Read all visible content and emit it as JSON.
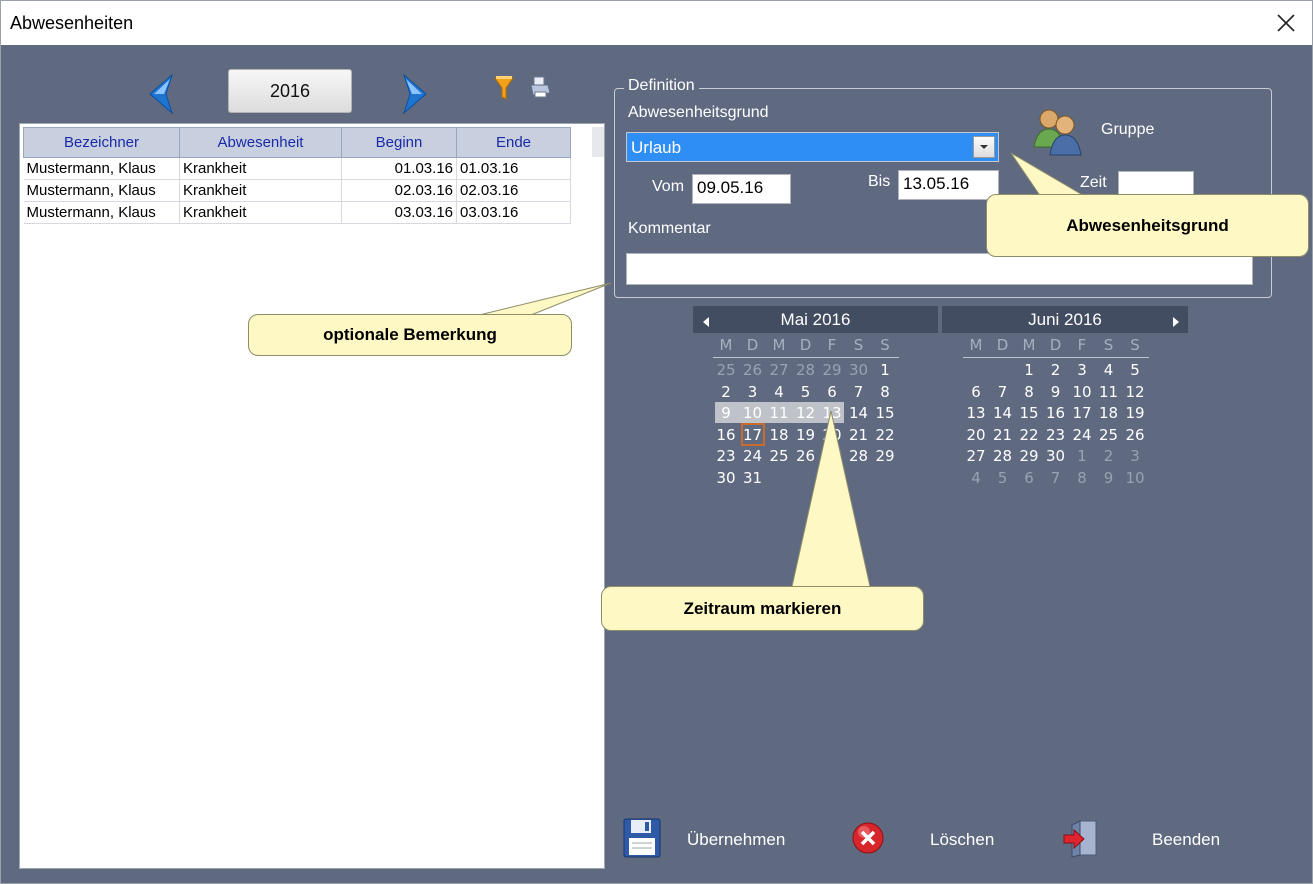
{
  "window": {
    "title": "Abwesenheiten"
  },
  "toolbar": {
    "year": "2016"
  },
  "table": {
    "headers": [
      "Bezeichner",
      "Abwesenheit",
      "Beginn",
      "Ende"
    ],
    "rows": [
      [
        "Mustermann, Klaus",
        "Krankheit",
        "01.03.16",
        "01.03.16"
      ],
      [
        "Mustermann, Klaus",
        "Krankheit",
        "02.03.16",
        "02.03.16"
      ],
      [
        "Mustermann, Klaus",
        "Krankheit",
        "03.03.16",
        "03.03.16"
      ]
    ]
  },
  "definition": {
    "group_label": "Definition",
    "reason_label": "Abwesenheitsgrund",
    "reason_value": "Urlaub",
    "group_button": "Gruppe",
    "from_label": "Vom",
    "from_value": "09.05.16",
    "to_label": "Bis",
    "to_value": "13.05.16",
    "time_label": "Zeit",
    "time_value": "",
    "comment_label": "Kommentar",
    "comment_value": ""
  },
  "calendar": {
    "weekday_headers": [
      "M",
      "D",
      "M",
      "D",
      "F",
      "S",
      "S"
    ],
    "month1": {
      "title": "Mai 2016",
      "weeks": [
        [
          "25",
          "26",
          "27",
          "28",
          "29",
          "30",
          "1"
        ],
        [
          "2",
          "3",
          "4",
          "5",
          "6",
          "7",
          "8"
        ],
        [
          "9",
          "10",
          "11",
          "12",
          "13",
          "14",
          "15"
        ],
        [
          "16",
          "17",
          "18",
          "19",
          "20",
          "21",
          "22"
        ],
        [
          "23",
          "24",
          "25",
          "26",
          "27",
          "28",
          "29"
        ],
        [
          "30",
          "31",
          "",
          "",
          "",
          "",
          ""
        ]
      ]
    },
    "month2": {
      "title": "Juni 2016",
      "weeks": [
        [
          "",
          "",
          "1",
          "2",
          "3",
          "4",
          "5"
        ],
        [
          "6",
          "7",
          "8",
          "9",
          "10",
          "11",
          "12"
        ],
        [
          "13",
          "14",
          "15",
          "16",
          "17",
          "18",
          "19"
        ],
        [
          "20",
          "21",
          "22",
          "23",
          "24",
          "25",
          "26"
        ],
        [
          "27",
          "28",
          "29",
          "30",
          "1",
          "2",
          "3"
        ],
        [
          "4",
          "5",
          "6",
          "7",
          "8",
          "9",
          "10"
        ]
      ]
    }
  },
  "callouts": {
    "reason": "Abwesenheitsgrund",
    "comment": "optionale Bemerkung",
    "period": "Zeitraum markieren"
  },
  "actions": {
    "save": "Übernehmen",
    "delete": "Löschen",
    "exit": "Beenden"
  },
  "colors": {
    "panel": "#5f6a80",
    "selection": "#2f8ef4",
    "header_text": "#1b2aa8",
    "callout": "#fdf8c4"
  }
}
